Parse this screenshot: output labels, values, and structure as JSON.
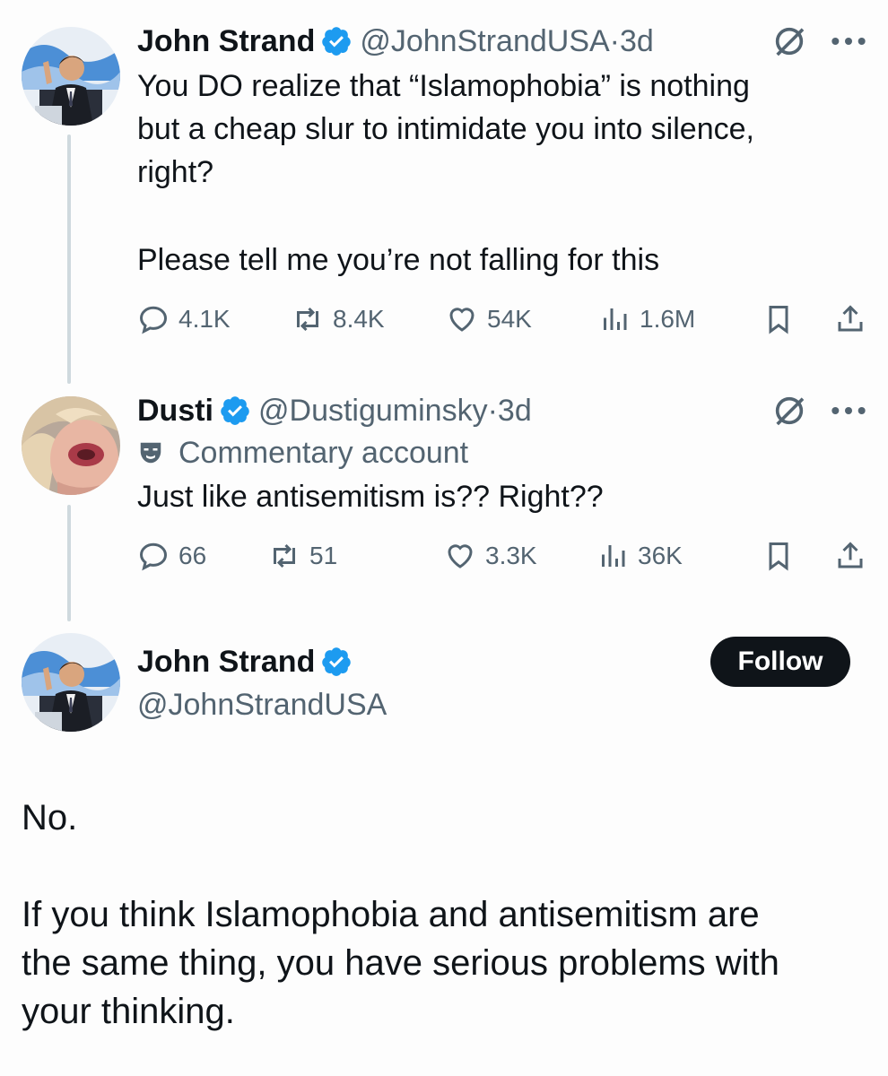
{
  "tweets": [
    {
      "name": "John Strand",
      "handle": "@JohnStrandUSA",
      "time": "3d",
      "lines": [
        "You DO realize that “Islamophobia” is nothing",
        "but a cheap slur to intimidate you into silence,",
        "right?",
        "",
        "Please tell me you’re not falling for this"
      ],
      "stats": {
        "replies": "4.1K",
        "reposts": "8.4K",
        "likes": "54K",
        "views": "1.6M"
      }
    },
    {
      "name": "Dusti",
      "handle": "@Dustiguminsky",
      "time": "3d",
      "label": "Commentary account",
      "lines": [
        "Just like antisemitism is?? Right??"
      ],
      "stats": {
        "replies": "66",
        "reposts": "51",
        "likes": "3.3K",
        "views": "36K"
      }
    }
  ],
  "main": {
    "name": "John Strand",
    "handle": "@JohnStrandUSA",
    "follow_label": "Follow",
    "paragraphs": [
      "No.",
      "If you think Islamophobia and antisemitism are",
      "the same thing, you have serious problems with",
      "your thinking."
    ]
  },
  "colors": {
    "verified": "#1d9bf0",
    "follow_bg": "#0f1419",
    "muted": "#536471",
    "thread": "#cfd9de"
  }
}
